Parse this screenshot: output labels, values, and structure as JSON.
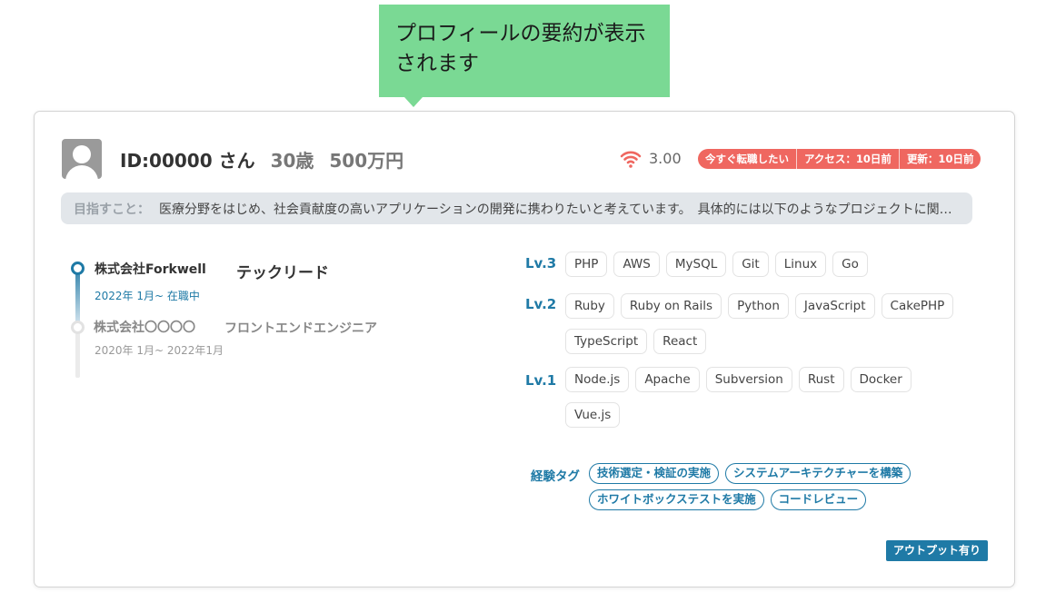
{
  "tooltip": {
    "text": "プロフィールの要約が表示されます"
  },
  "profile": {
    "id_text": "ID:00000 さん",
    "age": "30歳",
    "salary": "500万円",
    "signal_icon": "wifi-signal-icon",
    "score": "3.00",
    "badges": [
      "今すぐ転職したい",
      "アクセス：10日前",
      "更新：10日前"
    ],
    "goal_label": "目指すこと：",
    "goal_text": "医療分野をはじめ、社会貢献度の高いアプリケーションの開発に携わりたいと考えています。　具体的には以下のようなプロジェクトに関…"
  },
  "career": [
    {
      "company": "株式会社Forkwell",
      "role": "テックリード",
      "period": "2022年 1月~ 在職中"
    },
    {
      "company": "株式会社〇〇〇〇",
      "role": "フロントエンドエンジニア",
      "period": "2020年 1月~ 2022年1月"
    }
  ],
  "skills": {
    "levels": [
      {
        "label": "Lv.3",
        "tags": [
          "PHP",
          "AWS",
          "MySQL",
          "Git",
          "Linux",
          "Go"
        ]
      },
      {
        "label": "Lv.2",
        "tags": [
          "Ruby",
          "Ruby on Rails",
          "Python",
          "JavaScript",
          "CakePHP",
          "TypeScript",
          "React"
        ]
      },
      {
        "label": "Lv.1",
        "tags": [
          "Node.js",
          "Apache",
          "Subversion",
          "Rust",
          "Docker",
          "Vue.js"
        ]
      }
    ]
  },
  "experience": {
    "label": "経験タグ",
    "tags": [
      "技術選定・検証の実施",
      "システムアーキテクチャーを構築",
      "ホワイトボックステストを実施",
      "コードレビュー"
    ]
  },
  "output_badge": "アウトプット有り",
  "colors": {
    "accent": "#1f7aa6",
    "alert": "#ef6760",
    "tooltip": "#7ad994"
  }
}
